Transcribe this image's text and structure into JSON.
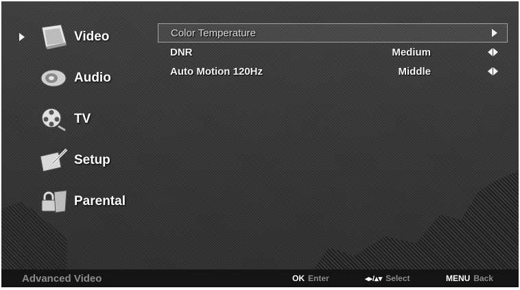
{
  "sidebar": {
    "selected_index": 0,
    "items": [
      {
        "label": "Video",
        "icon": "video-icon"
      },
      {
        "label": "Audio",
        "icon": "audio-icon"
      },
      {
        "label": "TV",
        "icon": "tv-reel-icon"
      },
      {
        "label": "Setup",
        "icon": "setup-icon"
      },
      {
        "label": "Parental",
        "icon": "parental-lock-icon"
      }
    ]
  },
  "panel": {
    "rows": [
      {
        "label": "Color Temperature",
        "value": "",
        "control": "submenu-arrow-icon",
        "highlighted": true
      },
      {
        "label": "DNR",
        "value": "Medium",
        "control": "left-right-arrows-icon"
      },
      {
        "label": "Auto Motion 120Hz",
        "value": "Middle",
        "control": "left-right-arrows-icon"
      }
    ]
  },
  "footer": {
    "title": "Advanced Video",
    "ok_key": "OK",
    "ok_desc": "Enter",
    "nav_symbol": "◂▸/▴▾",
    "nav_desc": "Select",
    "menu_key": "MENU",
    "menu_desc": "Back"
  },
  "colors": {
    "background": "#333333",
    "text": "#ffffff",
    "dim_text": "#8c8c8c",
    "footer_bar": "#141414"
  }
}
